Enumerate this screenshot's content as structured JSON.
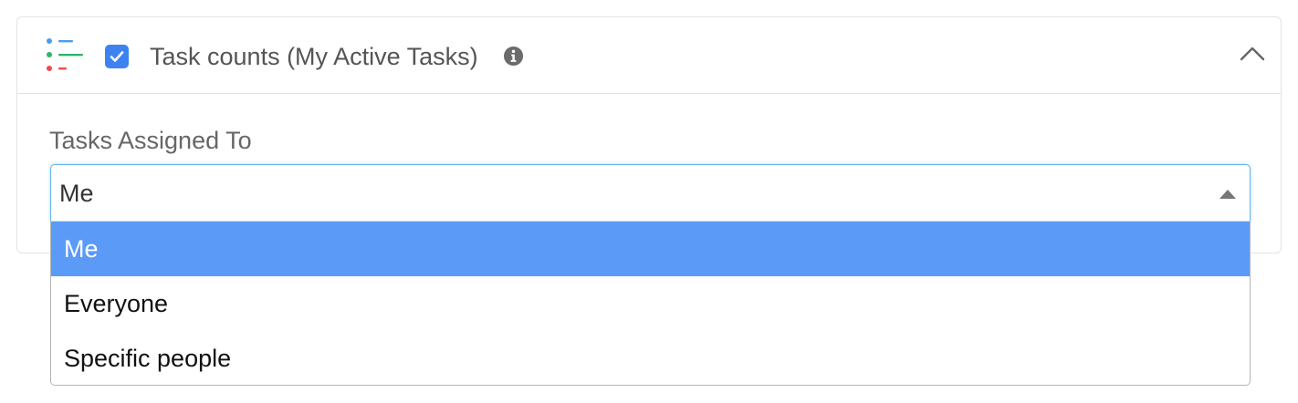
{
  "widget": {
    "icon": "list-icon",
    "enabled": true,
    "title": "Task counts (My Active Tasks)",
    "info_icon": "info-icon",
    "collapse_icon": "chevron-up-icon"
  },
  "field": {
    "label": "Tasks Assigned To",
    "selected_value": "Me",
    "options": [
      {
        "label": "Me",
        "selected": true
      },
      {
        "label": "Everyone",
        "selected": false
      },
      {
        "label": "Specific people",
        "selected": false
      }
    ]
  },
  "colors": {
    "accent": "#3d82f0",
    "option_highlight": "#5b9af7",
    "icon_blue": "#4a9cf0",
    "icon_green": "#2fb56a",
    "icon_red": "#ef4a4a"
  }
}
